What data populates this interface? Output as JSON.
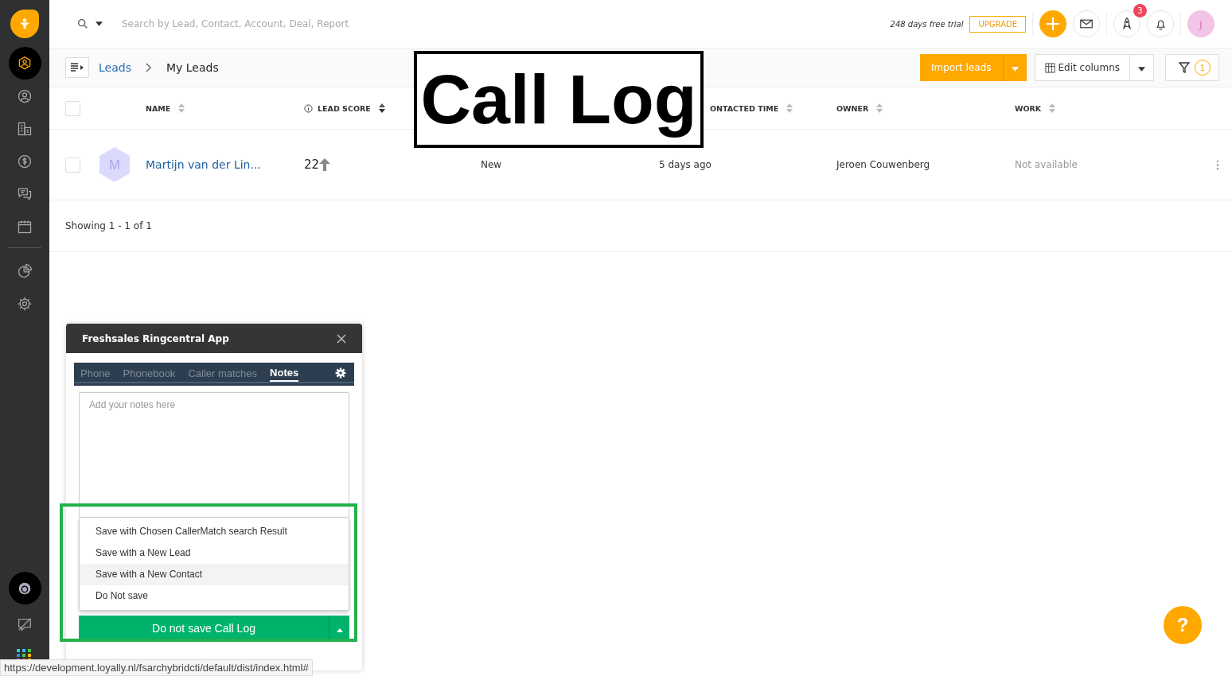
{
  "sidebar": {
    "items": [
      {
        "kind": "leads",
        "selected": true
      },
      {
        "kind": "contacts",
        "selected": false
      },
      {
        "kind": "accounts",
        "selected": false
      },
      {
        "kind": "deals",
        "selected": false
      },
      {
        "kind": "chat",
        "selected": false
      },
      {
        "kind": "calendar",
        "selected": false
      },
      {
        "kind": "reports",
        "selected": false
      },
      {
        "kind": "settings",
        "selected": false
      }
    ]
  },
  "topbar": {
    "search": {
      "placeholder": "Search by Lead, Contact, Account, Deal, Report"
    },
    "trial": "248 days free trial",
    "upgrade": "UPGRADE",
    "notification_count": "3",
    "avatar": "J"
  },
  "breadcrumb": [
    "Leads",
    "My Leads"
  ],
  "actions": {
    "import": "Import leads",
    "edit_columns": "Edit columns",
    "filter_count": "1"
  },
  "table": {
    "select_all": {
      "checked": false
    },
    "columns": [
      {
        "kind": "name",
        "label": "NAME"
      },
      {
        "kind": "score",
        "label": "LEAD SCORE"
      },
      {
        "kind": "covered"
      },
      {
        "kind": "contacted",
        "label": "ONTACTED TIME"
      },
      {
        "kind": "owner",
        "label": "OWNER"
      },
      {
        "kind": "work",
        "label": "WORK"
      }
    ],
    "rows": [
      {
        "checked": false,
        "avatar": "M",
        "name": "Martijn van der Lin...",
        "score": "22",
        "stage": "New",
        "contacted": "5 days ago",
        "owner": "Jeroen Couwenberg",
        "work": "Not available"
      }
    ]
  },
  "footer": "Showing 1 - 1 of 1",
  "annotation": "Call Log",
  "popup": {
    "title": "Freshsales Ringcentral App",
    "tabs": [
      {
        "label": "Phone",
        "selected": false
      },
      {
        "label": "Phonebook",
        "selected": false
      },
      {
        "label": "Caller matches",
        "selected": false
      },
      {
        "label": "Notes",
        "selected": true
      }
    ],
    "notes": {
      "placeholder": "Add your notes here"
    },
    "options": [
      {
        "label": "Save with Chosen CallerMatch search Result",
        "selected": false
      },
      {
        "label": "Save with a New Lead",
        "selected": false
      },
      {
        "label": "Save with a New Contact",
        "selected": true
      },
      {
        "label": "Do Not save",
        "selected": false
      }
    ],
    "save_button": "Do not save Call Log"
  },
  "help": "?",
  "status_url": "https://development.loyally.nl/fsarchybridcti/default/dist/index.html#"
}
